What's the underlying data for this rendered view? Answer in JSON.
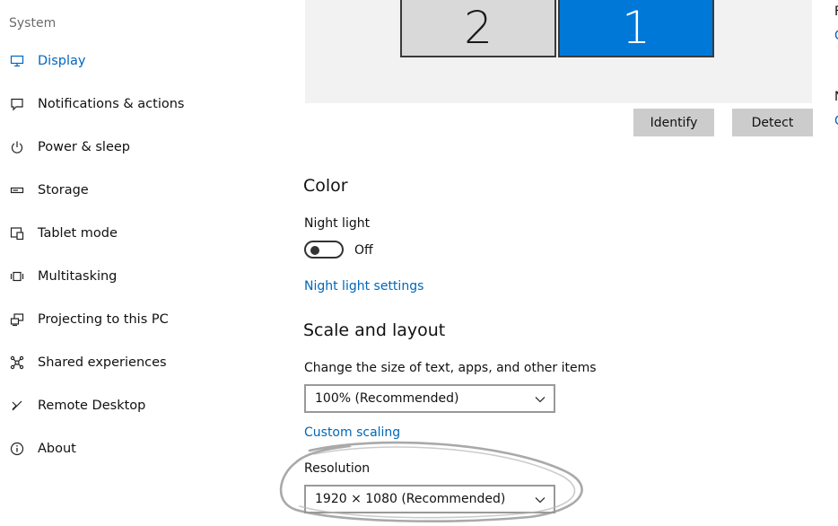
{
  "sidebar": {
    "section_label": "System",
    "items": [
      {
        "label": "Display",
        "icon": "monitor-icon",
        "active": true
      },
      {
        "label": "Notifications & actions",
        "icon": "notification-icon"
      },
      {
        "label": "Power & sleep",
        "icon": "power-icon"
      },
      {
        "label": "Storage",
        "icon": "storage-icon"
      },
      {
        "label": "Tablet mode",
        "icon": "tablet-icon"
      },
      {
        "label": "Multitasking",
        "icon": "multitasking-icon"
      },
      {
        "label": "Projecting to this PC",
        "icon": "projecting-icon"
      },
      {
        "label": "Shared experiences",
        "icon": "shared-experiences-icon"
      },
      {
        "label": "Remote Desktop",
        "icon": "remote-desktop-icon"
      },
      {
        "label": "About",
        "icon": "info-icon"
      }
    ]
  },
  "display_preview": {
    "monitors": [
      {
        "number": "2",
        "selected": false
      },
      {
        "number": "1",
        "selected": true
      }
    ],
    "identify_label": "Identify",
    "detect_label": "Detect"
  },
  "color": {
    "heading": "Color",
    "night_light_label": "Night light",
    "night_light_state": "Off",
    "night_light_settings_link": "Night light settings"
  },
  "scale_layout": {
    "heading": "Scale and layout",
    "scale_label": "Change the size of text, apps, and other items",
    "scale_value": "100% (Recommended)",
    "custom_scaling_link": "Custom scaling",
    "resolution_label": "Resolution",
    "resolution_value": "1920 × 1080 (Recommended)"
  },
  "colors": {
    "accent": "#0078d7",
    "link": "#0067b8",
    "button_bg": "#cccccc",
    "preview_bg": "#f2f2f2"
  }
}
